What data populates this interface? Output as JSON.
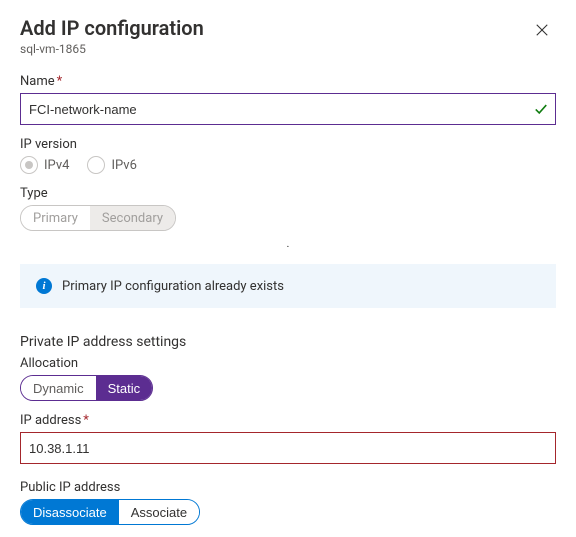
{
  "header": {
    "title": "Add IP configuration",
    "subtitle": "sql-vm-1865"
  },
  "name": {
    "label": "Name",
    "value": "FCI-network-name"
  },
  "ipVersion": {
    "label": "IP version",
    "options": {
      "ipv4": "IPv4",
      "ipv6": "IPv6"
    }
  },
  "type": {
    "label": "Type",
    "options": {
      "primary": "Primary",
      "secondary": "Secondary"
    }
  },
  "info": {
    "message": "Primary IP configuration already exists"
  },
  "privateIp": {
    "sectionTitle": "Private IP address settings",
    "allocation": {
      "label": "Allocation",
      "options": {
        "dynamic": "Dynamic",
        "static": "Static"
      }
    },
    "address": {
      "label": "IP address",
      "value": "10.38.1.11"
    }
  },
  "publicIp": {
    "label": "Public IP address",
    "options": {
      "disassociate": "Disassociate",
      "associate": "Associate"
    }
  }
}
